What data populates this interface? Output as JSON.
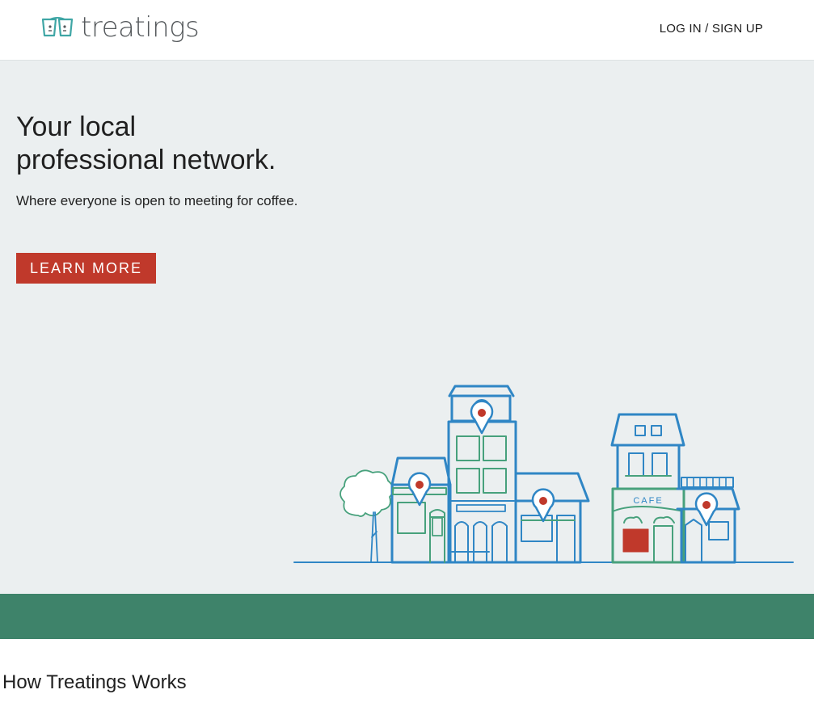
{
  "header": {
    "brand": "treatings",
    "auth_link": "LOG IN / SIGN UP"
  },
  "hero": {
    "title_line1": "Your local",
    "title_line2": "professional network.",
    "subtitle": "Where everyone is open to meeting for coffee.",
    "cta_label": "LEARN MORE",
    "illustration_sign": "CAFE"
  },
  "sections": {
    "how_it_works_title": "How Treatings Works"
  },
  "colors": {
    "brand_teal": "#3fa6a5",
    "accent_red": "#c0392b",
    "hero_bg": "#ebeff0",
    "band_green": "#3e836a",
    "illustration_blue": "#2f86c5",
    "illustration_green": "#47a17c"
  }
}
